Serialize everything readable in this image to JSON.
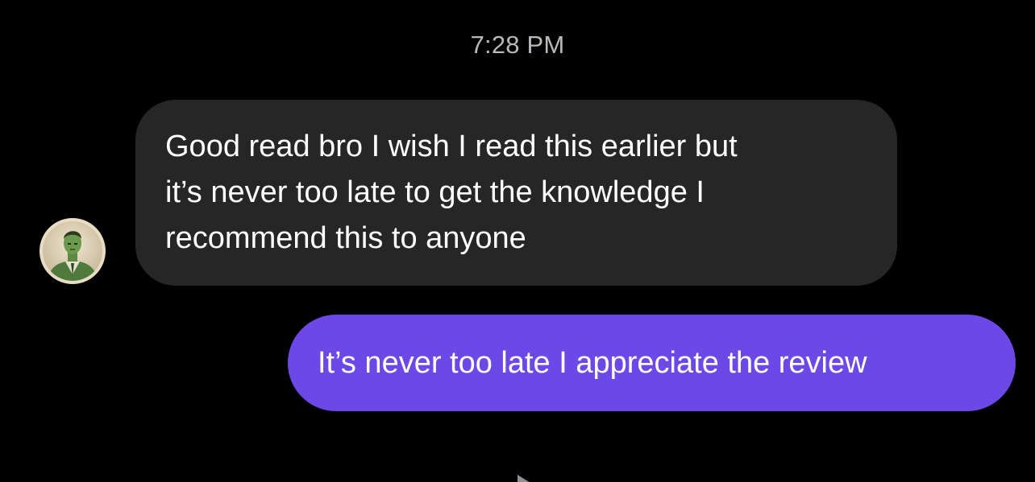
{
  "thread": {
    "timestamp": "7:28 PM",
    "messages": [
      {
        "direction": "incoming",
        "lines": [
          "Good read bro I wish I read this earlier but",
          "it’s never too late to get the knowledge I",
          "recommend this to anyone"
        ]
      },
      {
        "direction": "outgoing",
        "text": "It’s never too late I appreciate the review"
      }
    ]
  },
  "colors": {
    "background": "#000000",
    "incoming_bubble": "#262626",
    "outgoing_bubble": "#6c48e6",
    "timestamp_text": "#b9b9bd",
    "message_text": "#ffffff"
  },
  "icons": {
    "avatar": "avatar-portrait-icon",
    "bottom": "seen-indicator-icon"
  }
}
